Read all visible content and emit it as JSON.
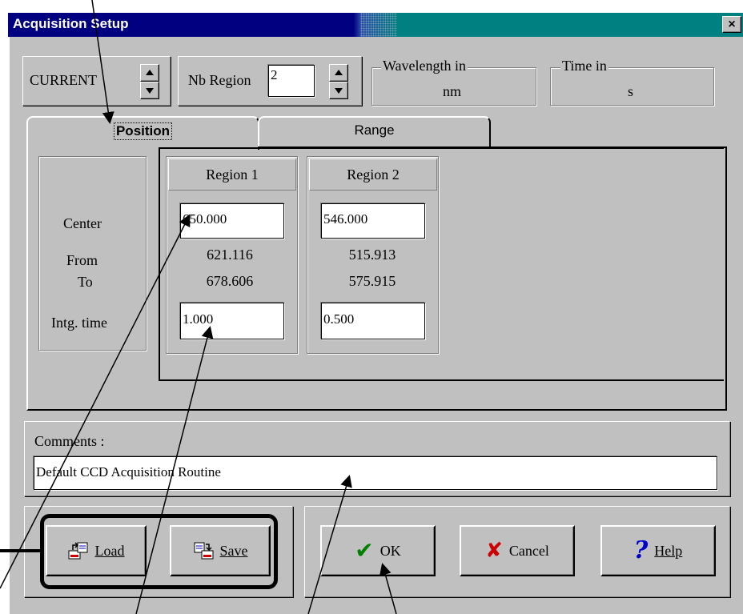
{
  "window": {
    "title": "Acquisition Setup",
    "close_label": "×"
  },
  "top": {
    "mode_label": "CURRENT",
    "nb_region_label": "Nb Region",
    "nb_region_value": "2",
    "wavelength_title": "Wavelength in",
    "wavelength_unit": "nm",
    "time_title": "Time in",
    "time_unit": "s"
  },
  "tabs": [
    {
      "label": "Position",
      "active": true
    },
    {
      "label": "Range",
      "active": false
    }
  ],
  "row_labels": {
    "center": "Center",
    "from": "From",
    "to": "To",
    "intg": "Intg. time"
  },
  "regions": [
    {
      "header": "Region 1",
      "center": "650.000",
      "from": "621.116",
      "to": "678.606",
      "intg_time": "1.000"
    },
    {
      "header": "Region 2",
      "center": "546.000",
      "from": "515.913",
      "to": "575.915",
      "intg_time": "0.500"
    }
  ],
  "comments": {
    "label": "Comments :",
    "value": "Default CCD Acquisition Routine"
  },
  "buttons": {
    "load": "Load",
    "save": "Save",
    "ok": "OK",
    "cancel": "Cancel",
    "help": "Help"
  },
  "icons": {
    "close": "close-icon",
    "load": "load-icon",
    "save": "save-icon",
    "ok": "check-icon",
    "cancel": "x-icon",
    "help": "question-icon"
  },
  "colors": {
    "titlebar": "#000080",
    "dialog": "#c0c0c0",
    "ok_check": "#008000",
    "cancel_x": "#cc0000",
    "help_q": "#0000cc"
  }
}
